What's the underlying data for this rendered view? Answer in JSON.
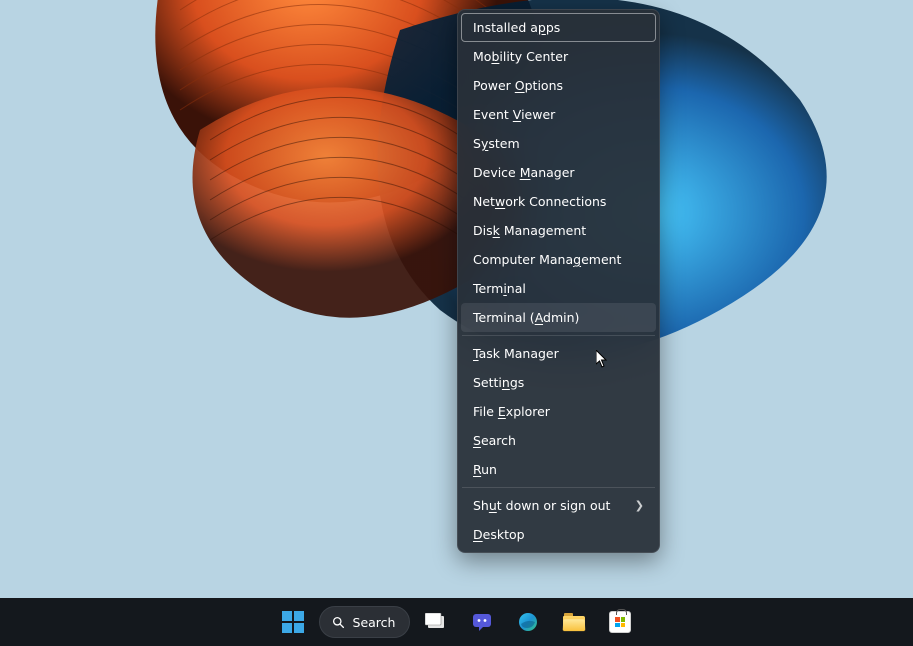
{
  "context_menu": {
    "items": [
      {
        "pre": "Installed a",
        "u": "p",
        "post": "ps"
      },
      {
        "pre": "Mo",
        "u": "b",
        "post": "ility Center"
      },
      {
        "pre": "Power ",
        "u": "O",
        "post": "ptions"
      },
      {
        "pre": "Event ",
        "u": "V",
        "post": "iewer"
      },
      {
        "pre": "S",
        "u": "y",
        "post": "stem"
      },
      {
        "pre": "Device ",
        "u": "M",
        "post": "anager"
      },
      {
        "pre": "Net",
        "u": "w",
        "post": "ork Connections"
      },
      {
        "pre": "Dis",
        "u": "k",
        "post": " Management"
      },
      {
        "pre": "Computer Mana",
        "u": "g",
        "post": "ement"
      },
      {
        "pre": "Term",
        "u": "i",
        "post": "nal"
      },
      {
        "pre": "Terminal (",
        "u": "A",
        "post": "dmin)"
      }
    ],
    "items2": [
      {
        "pre": "",
        "u": "T",
        "post": "ask Manager"
      },
      {
        "pre": "Setti",
        "u": "n",
        "post": "gs"
      },
      {
        "pre": "File ",
        "u": "E",
        "post": "xplorer"
      },
      {
        "pre": "",
        "u": "S",
        "post": "earch"
      },
      {
        "pre": "",
        "u": "R",
        "post": "un"
      }
    ],
    "items3": [
      {
        "pre": "Sh",
        "u": "u",
        "post": "t down or sign out",
        "submenu": true
      },
      {
        "pre": "",
        "u": "D",
        "post": "esktop"
      }
    ],
    "focused_index": 0,
    "hover_index": 10
  },
  "taskbar": {
    "search_label": "Search"
  }
}
